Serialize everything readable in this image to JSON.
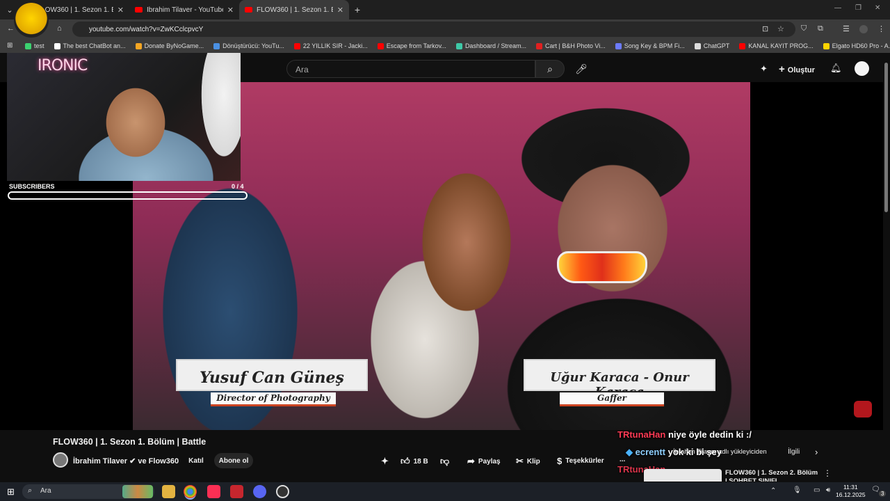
{
  "browser": {
    "tabs": [
      {
        "title": "FLOW360 | 1. Sezon 1. Bölüm |"
      },
      {
        "title": "İbrahim Tilaver - YouTube"
      },
      {
        "title": "FLOW360 | 1. Sezon 1. Bölüm |"
      }
    ],
    "new_tab": "+",
    "url": "youtube.com/watch?v=ZwKCclcpvcY",
    "bookmarks": [
      {
        "label": "test",
        "color": "#3bd16f"
      },
      {
        "label": "The best ChatBot an...",
        "color": "#ffffff"
      },
      {
        "label": "Donate ByNoGame...",
        "color": "#f5a623"
      },
      {
        "label": "Dönüştürücü: YouTu...",
        "color": "#4a90e2"
      },
      {
        "label": "22 YILLIK SIR - Jacki...",
        "color": "#ff0000"
      },
      {
        "label": "Escape from Tarkov...",
        "color": "#ff0000"
      },
      {
        "label": "Dashboard / Stream...",
        "color": "#3ec9a7"
      },
      {
        "label": "Cart | B&H Photo Vi...",
        "color": "#e02020"
      },
      {
        "label": "Song Key & BPM Fi...",
        "color": "#6c7bff"
      },
      {
        "label": "ChatGPT",
        "color": "#dddddd"
      },
      {
        "label": "KANAL KAYIT PROG...",
        "color": "#ff0000"
      },
      {
        "label": "Elgato HD60 Pro - A...",
        "color": "#ffd400"
      }
    ]
  },
  "youtube": {
    "search_placeholder": "Ara",
    "create_label": "Oluştur",
    "video": {
      "title": "FLOW360 | 1. Sezon 1. Bölüm | Battle",
      "channel": "İbrahim Tilaver ✔ ve Flow360",
      "join_label": "Katıl",
      "subscribe_label": "Abone ol",
      "likes": "18 B",
      "share_label": "Paylaş",
      "clip_label": "Klip",
      "thanks_label": "Teşekkürler",
      "more": "..."
    },
    "lower_thirds": [
      {
        "name": "Yusuf Can Güneş",
        "role": "Director of Photography"
      },
      {
        "name": "Uğur Karaca - Onur Karaca",
        "role": "Gaffer"
      }
    ],
    "sidebar": {
      "meta": "İbrahim Tilaver adlı yükleyiciden",
      "related_tab": "İlgili",
      "related_title": "FLOW360 | 1. Sezon 2. Bölüm | SOHBET SINIFI"
    }
  },
  "stream_overlay": {
    "logo": "IRONIC",
    "subs_label": "SUBSCRIBERS",
    "subs_count": "0 / 4",
    "subs_progress": 0,
    "chat": [
      {
        "user": "TRtunaHan",
        "message": "niye öyle dedin ki :/"
      },
      {
        "user": "ecrentt",
        "message": "yok ki bi şey"
      },
      {
        "user": "TRtunaHan",
        "message": ""
      }
    ]
  },
  "taskbar": {
    "search_placeholder": "Ara",
    "time": "11:31",
    "date": "16.12.2025",
    "notification_count": "3"
  }
}
